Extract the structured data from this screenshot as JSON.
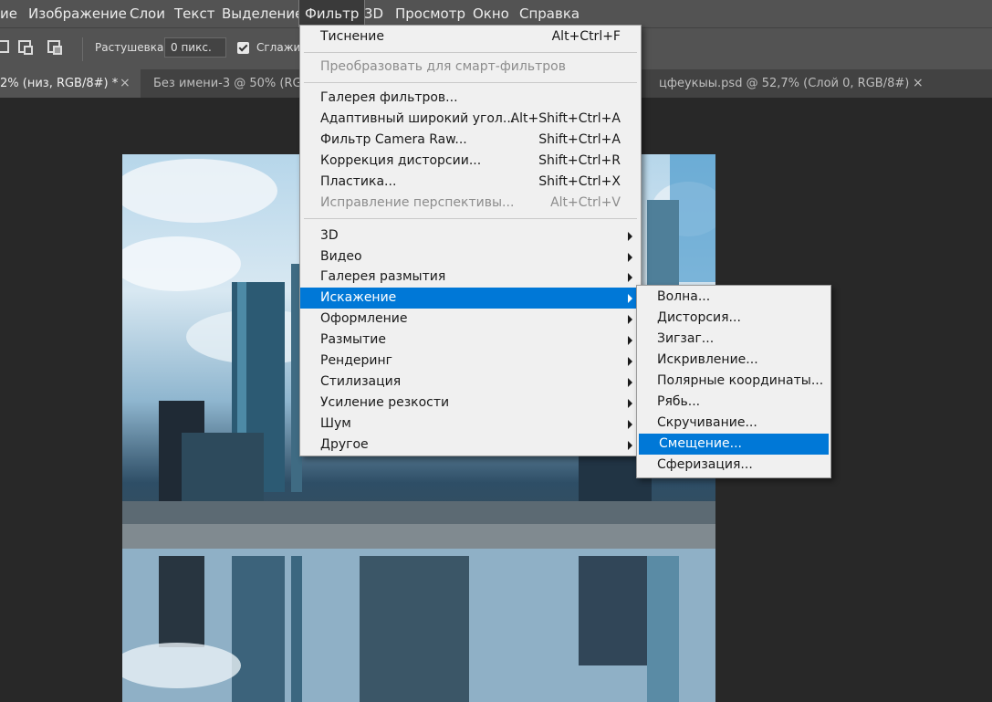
{
  "menubar": {
    "items": [
      "ие",
      "Изображение",
      "Слои",
      "Текст",
      "Выделение",
      "Фильтр",
      "3D",
      "Просмотр",
      "Окно",
      "Справка"
    ],
    "active_index": 5
  },
  "optbar": {
    "feather_label": "Растушевка:",
    "feather_value": "0 пикс.",
    "antialias_label": "Сглажив",
    "antialias_checked": true
  },
  "tabs": [
    {
      "label": "2% (низ, RGB/8#) *",
      "close": "×",
      "active": true
    },
    {
      "label": "Без имени-3 @ 50% (RG",
      "close": "",
      "active": false
    },
    {
      "label": "цфеукыы.psd @ 52,7% (Слой 0, RGB/8#)",
      "close": "×",
      "active": false
    }
  ],
  "filter_menu": {
    "items": [
      {
        "label": "Тиснение",
        "shortcut": "Alt+Ctrl+F"
      },
      {
        "label": "Преобразовать для смарт-фильтров",
        "disabled": true
      },
      {
        "label": "Галерея фильтров..."
      },
      {
        "label": "Адаптивный широкий угол...",
        "shortcut": "Alt+Shift+Ctrl+A"
      },
      {
        "label": "Фильтр Camera Raw...",
        "shortcut": "Shift+Ctrl+A"
      },
      {
        "label": "Коррекция дисторсии...",
        "shortcut": "Shift+Ctrl+R"
      },
      {
        "label": "Пластика...",
        "shortcut": "Shift+Ctrl+X"
      },
      {
        "label": "Исправление перспективы...",
        "shortcut": "Alt+Ctrl+V",
        "disabled": true
      },
      {
        "label": "3D",
        "submenu": true
      },
      {
        "label": "Видео",
        "submenu": true
      },
      {
        "label": "Галерея размытия",
        "submenu": true
      },
      {
        "label": "Искажение",
        "submenu": true,
        "highlighted": true
      },
      {
        "label": "Оформление",
        "submenu": true
      },
      {
        "label": "Размытие",
        "submenu": true
      },
      {
        "label": "Рендеринг",
        "submenu": true
      },
      {
        "label": "Стилизация",
        "submenu": true
      },
      {
        "label": "Усиление резкости",
        "submenu": true
      },
      {
        "label": "Шум",
        "submenu": true
      },
      {
        "label": "Другое",
        "submenu": true
      }
    ]
  },
  "distort_submenu": {
    "items": [
      {
        "label": "Волна..."
      },
      {
        "label": "Дисторсия..."
      },
      {
        "label": "Зигзаг..."
      },
      {
        "label": "Искривление..."
      },
      {
        "label": "Полярные координаты..."
      },
      {
        "label": "Рябь..."
      },
      {
        "label": "Скручивание..."
      },
      {
        "label": "Смещение...",
        "highlighted": true
      },
      {
        "label": "Сферизация..."
      }
    ]
  },
  "colors": {
    "highlight": "#0078d7",
    "menu_bg": "#f0f0f0",
    "app_bg": "#535353",
    "workspace": "#282828"
  }
}
